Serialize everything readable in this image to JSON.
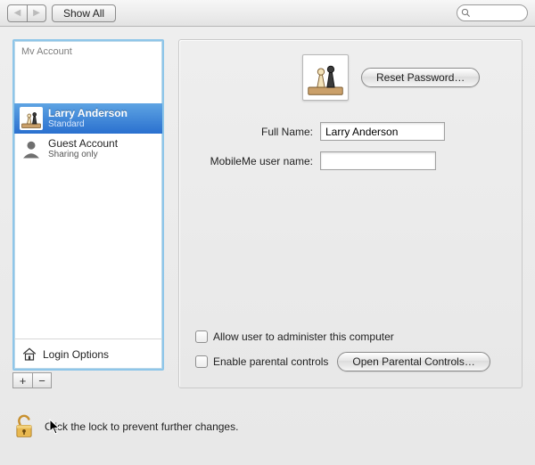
{
  "toolbar": {
    "show_all_label": "Show All",
    "search_placeholder": ""
  },
  "sidebar": {
    "header": "Mv Account",
    "items": [
      {
        "title": "Larry Anderson",
        "sub": "Standard",
        "selected": true,
        "avatar": "chess"
      },
      {
        "title": "Guest Account",
        "sub": "Sharing only",
        "selected": false,
        "avatar": "generic"
      }
    ],
    "footer_label": "Login Options"
  },
  "detail": {
    "reset_password_label": "Reset Password…",
    "full_name_label": "Full Name:",
    "full_name_value": "Larry Anderson",
    "mobileme_label": "MobileMe user name:",
    "mobileme_value": "",
    "admin_checkbox_label": "Allow user to administer this computer",
    "parental_checkbox_label": "Enable parental controls",
    "open_parental_label": "Open Parental Controls…"
  },
  "lock_text": "Click the lock to prevent further changes."
}
